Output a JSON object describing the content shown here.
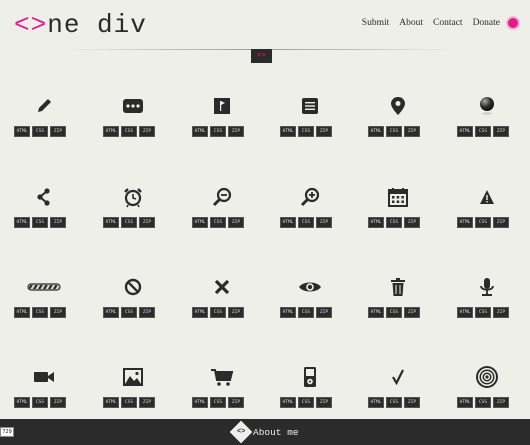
{
  "header": {
    "logo_open": "<>",
    "logo_rest": "ne div",
    "nav": {
      "submit": "Submit",
      "about": "About",
      "contact": "Contact",
      "donate": "Donate"
    },
    "badge": "<>"
  },
  "colors": {
    "accent": "#e6198a",
    "dark": "#2b2b2b",
    "background": "#efefea"
  },
  "buttons": {
    "html": "HTML",
    "css": "CSS",
    "zip": "ZIP"
  },
  "icons": [
    [
      "pencil-icon",
      "dots-icon",
      "flag-icon",
      "document-lines-icon",
      "map-pin-icon",
      "ball-icon"
    ],
    [
      "share-icon",
      "alarm-clock-icon",
      "zoom-out-icon",
      "zoom-in-icon",
      "calendar-icon",
      "warning-icon"
    ],
    [
      "progress-bar-icon",
      "prohibited-icon",
      "close-icon",
      "eye-icon",
      "trash-icon",
      "microphone-icon"
    ],
    [
      "video-camera-icon",
      "image-icon",
      "cart-icon",
      "ipod-icon",
      "checkmark-icon",
      "target-icon"
    ]
  ],
  "footer": {
    "about_label": "About me",
    "logo_glyph": "<>"
  },
  "overlay": {
    "corner_number": "729"
  }
}
